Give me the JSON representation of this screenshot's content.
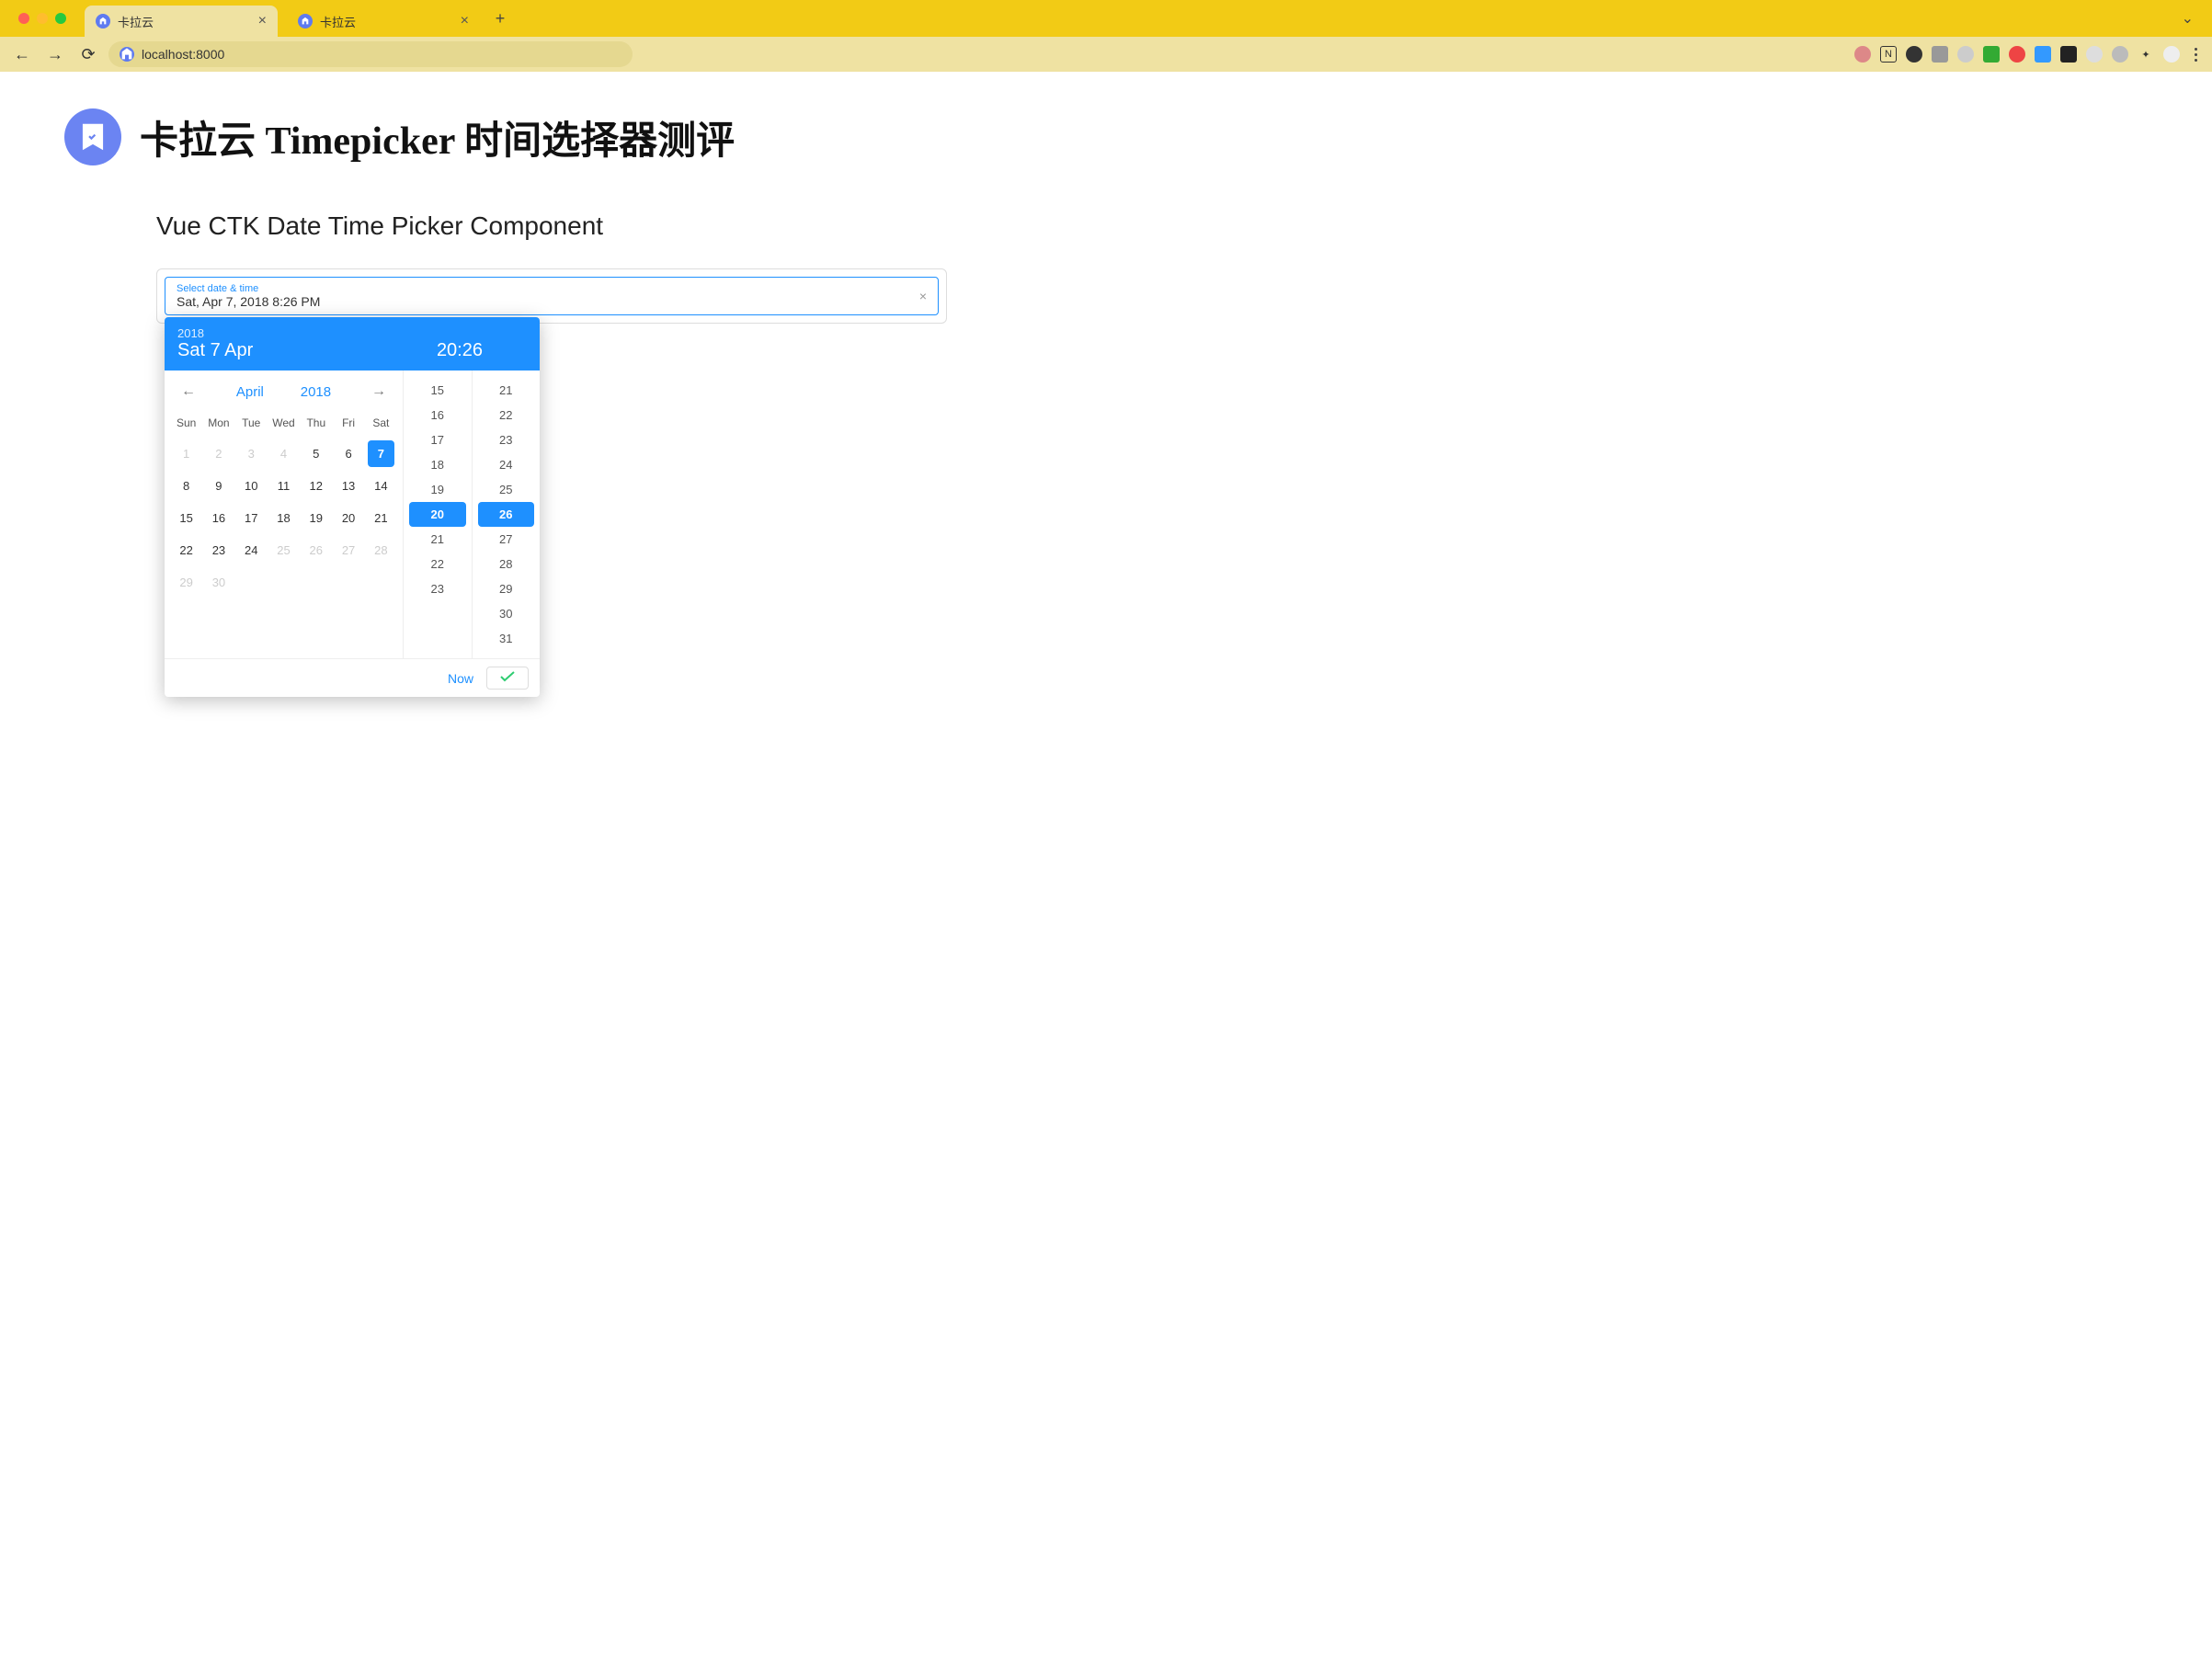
{
  "browser": {
    "tabs": [
      {
        "title": "卡拉云",
        "active": true
      },
      {
        "title": "卡拉云",
        "active": false
      }
    ],
    "url": "localhost:8000"
  },
  "page": {
    "title": "卡拉云 Timepicker 时间选择器测评",
    "section_title": "Vue CTK Date Time Picker Component"
  },
  "picker": {
    "input_label": "Select date & time",
    "input_value": "Sat, Apr 7, 2018 8:26 PM",
    "header": {
      "year": "2018",
      "date": "Sat 7 Apr",
      "time": "20:26"
    },
    "calendar": {
      "month": "April",
      "year": "2018",
      "dow": [
        "Sun",
        "Mon",
        "Tue",
        "Wed",
        "Thu",
        "Fri",
        "Sat"
      ],
      "cells": [
        {
          "v": "1",
          "muted": true
        },
        {
          "v": "2",
          "muted": true
        },
        {
          "v": "3",
          "muted": true
        },
        {
          "v": "4",
          "muted": true
        },
        {
          "v": "5"
        },
        {
          "v": "6"
        },
        {
          "v": "7",
          "selected": true
        },
        {
          "v": "8"
        },
        {
          "v": "9"
        },
        {
          "v": "10"
        },
        {
          "v": "11"
        },
        {
          "v": "12"
        },
        {
          "v": "13"
        },
        {
          "v": "14"
        },
        {
          "v": "15"
        },
        {
          "v": "16"
        },
        {
          "v": "17"
        },
        {
          "v": "18"
        },
        {
          "v": "19"
        },
        {
          "v": "20"
        },
        {
          "v": "21"
        },
        {
          "v": "22"
        },
        {
          "v": "23"
        },
        {
          "v": "24"
        },
        {
          "v": "25",
          "muted": true
        },
        {
          "v": "26",
          "muted": true
        },
        {
          "v": "27",
          "muted": true
        },
        {
          "v": "28",
          "muted": true
        },
        {
          "v": "29",
          "muted": true
        },
        {
          "v": "30",
          "muted": true
        }
      ]
    },
    "time": {
      "hours": [
        "15",
        "16",
        "17",
        "18",
        "19",
        "20",
        "21",
        "22",
        "23"
      ],
      "minutes": [
        "21",
        "22",
        "23",
        "24",
        "25",
        "26",
        "27",
        "28",
        "29",
        "30",
        "31"
      ],
      "selected_hour": "20",
      "selected_minute": "26"
    },
    "now_label": "Now"
  }
}
